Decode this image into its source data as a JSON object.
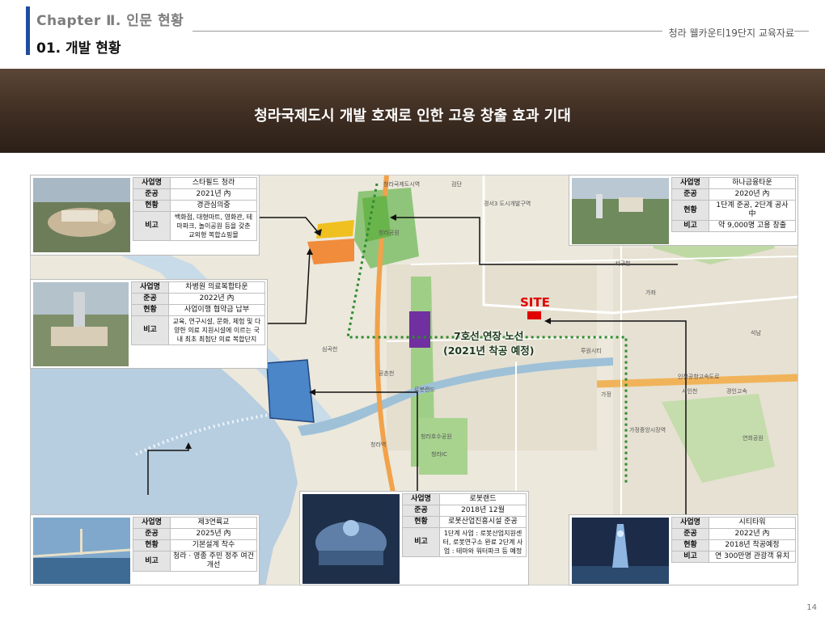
{
  "header": {
    "chapter": "Chapter Ⅱ. 인문 현황",
    "section": "01. 개발 현황",
    "doc_tag": "청라 웰카운티19단지 교육자료"
  },
  "banner": {
    "title": "청라국제도시 개발 호재로 인한 고용 창출 효과 기대"
  },
  "map": {
    "site_label": "SITE",
    "route_line1": "7호선 연장 노선",
    "route_line2": "(2021년 착공 예정)",
    "labels": [
      "청라국제도시역",
      "청라공원",
      "경서3 도시개발구역",
      "로봇랜드",
      "청라호수공원",
      "인천공항고속도로",
      "서인천",
      "가정",
      "가정중앙시장역",
      "연희공원",
      "공촌천",
      "서구청",
      "검단",
      "청라역",
      "청라IC",
      "루원시티",
      "경인고속",
      "가좌",
      "석남",
      "심곡천"
    ]
  },
  "cards": [
    {
      "rows": [
        [
          "사업명",
          "스타필드 청라"
        ],
        [
          "준공",
          "2021년 內"
        ],
        [
          "현황",
          "경관심의중"
        ],
        [
          "비고",
          "백화점, 대형마트, 영화관, 테마파크, 놀이공원 등을 갖춘 교외형 복합쇼핑몰"
        ]
      ]
    },
    {
      "rows": [
        [
          "사업명",
          "차병원 의료복합타운"
        ],
        [
          "준공",
          "2022년 內"
        ],
        [
          "현황",
          "사업이행 협약금 납부"
        ],
        [
          "비고",
          "교육, 연구시설, 문화, 체험 및 다양한 의료 지원시설에 이르는 국내 최초 최첨단 의료 복합단지"
        ]
      ]
    },
    {
      "rows": [
        [
          "사업명",
          "하나금융타운"
        ],
        [
          "준공",
          "2020년 內"
        ],
        [
          "현황",
          "1단계 준공, 2단계 공사 中"
        ],
        [
          "비고",
          "약 9,000명 고용 창출"
        ]
      ]
    },
    {
      "rows": [
        [
          "사업명",
          "제3연륙교"
        ],
        [
          "준공",
          "2025년 內"
        ],
        [
          "현황",
          "기본설계 착수"
        ],
        [
          "비고",
          "청라 · 영종 주민 정주 여건 개선"
        ]
      ]
    },
    {
      "rows": [
        [
          "사업명",
          "로봇랜드"
        ],
        [
          "준공",
          "2018년 12월"
        ],
        [
          "현황",
          "로봇산업진흥시설 준공"
        ],
        [
          "비고",
          "1단계 사업 : 로봇산업지원센터, 로봇연구소 완료 2단계 사업 : 테마와 워터파크 등 예정"
        ]
      ]
    },
    {
      "rows": [
        [
          "사업명",
          "시티타워"
        ],
        [
          "준공",
          "2022년 內"
        ],
        [
          "현황",
          "2018년 착공예정"
        ],
        [
          "비고",
          "연 300만명 관광객 유치"
        ]
      ]
    }
  ],
  "page_number": "14",
  "colors": {
    "accent": "#1f4e9e",
    "site": "#e00000",
    "route": "#2e8b2e",
    "banner": "#3e2d22"
  }
}
